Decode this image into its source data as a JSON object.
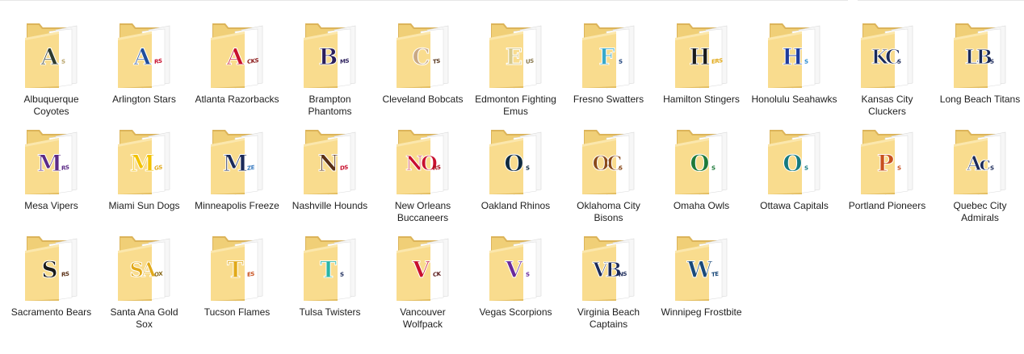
{
  "window": {
    "view": "large-icons"
  },
  "folders": [
    {
      "label": "Albuquerque Coyotes",
      "mono": "A",
      "color": "#2f3b2f",
      "accent": "#b9a46a",
      "tag": "S"
    },
    {
      "label": "Arlington Stars",
      "mono": "A",
      "color": "#1f4e9c",
      "accent": "#c8102e",
      "tag": "RS"
    },
    {
      "label": "Atlanta Razorbacks",
      "mono": "A",
      "color": "#c8102e",
      "accent": "#8b1a1a",
      "tag": "CKS"
    },
    {
      "label": "Brampton Phantoms",
      "mono": "B",
      "color": "#2b1f5c",
      "accent": "#2b1f5c",
      "tag": "MS"
    },
    {
      "label": "Cleveland Bobcats",
      "mono": "C",
      "color": "#c9a985",
      "accent": "#5a3a22",
      "tag": "TS"
    },
    {
      "label": "Edmonton Fighting Emus",
      "mono": "E",
      "color": "#d7c98a",
      "accent": "#8a7a50",
      "tag": "US"
    },
    {
      "label": "Fresno Swatters",
      "mono": "F",
      "color": "#3aa9c9",
      "accent": "#1b3f7a",
      "tag": "S"
    },
    {
      "label": "Hamilton Stingers",
      "mono": "H",
      "color": "#1a1a1a",
      "accent": "#e1a91a",
      "tag": "ERS"
    },
    {
      "label": "Honolulu Seahawks",
      "mono": "H",
      "color": "#1f3c9c",
      "accent": "#2a8bd1",
      "tag": "S"
    },
    {
      "label": "Kansas City Cluckers",
      "mono": "KC",
      "color": "#1b2a5a",
      "accent": "#1b2a5a",
      "tag": "S"
    },
    {
      "label": "Long Beach Titans",
      "mono": "LB",
      "color": "#1b2a5a",
      "accent": "#1b2a5a",
      "tag": "S"
    },
    {
      "label": "Mesa Vipers",
      "mono": "M",
      "color": "#5b2a86",
      "accent": "#5b2a86",
      "tag": "RS"
    },
    {
      "label": "Miami Sun Dogs",
      "mono": "M",
      "color": "#f2c200",
      "accent": "#e1a91a",
      "tag": "GS"
    },
    {
      "label": "Minneapolis Freeze",
      "mono": "M",
      "color": "#1b2a5a",
      "accent": "#3a7cc1",
      "tag": "ZE"
    },
    {
      "label": "Nashville Hounds",
      "mono": "N",
      "color": "#5a3016",
      "accent": "#c8102e",
      "tag": "DS"
    },
    {
      "label": "New Orleans Buccaneers",
      "mono": "NO",
      "color": "#c8102e",
      "accent": "#a8101e",
      "tag": "RS"
    },
    {
      "label": "Oakland Rhinos",
      "mono": "O",
      "color": "#0f2a3f",
      "accent": "#0f2a3f",
      "tag": "S"
    },
    {
      "label": "Oklahoma City Bisons",
      "mono": "OC",
      "color": "#8a4a1a",
      "accent": "#8a4a1a",
      "tag": "S"
    },
    {
      "label": "Omaha Owls",
      "mono": "O",
      "color": "#1e7a3a",
      "accent": "#1e7a3a",
      "tag": "S"
    },
    {
      "label": "Ottawa Capitals",
      "mono": "O",
      "color": "#157a80",
      "accent": "#157a80",
      "tag": "S"
    },
    {
      "label": "Portland Pioneers",
      "mono": "P",
      "color": "#c8501e",
      "accent": "#c8501e",
      "tag": "S"
    },
    {
      "label": "Quebec City Admirals",
      "mono": "Ac",
      "color": "#1b2a5a",
      "accent": "#1b2a5a",
      "tag": "S"
    },
    {
      "label": "Sacramento Bears",
      "mono": "S",
      "color": "#1a1a1a",
      "accent": "#5a3016",
      "tag": "RS"
    },
    {
      "label": "Santa Ana Gold Sox",
      "mono": "SA",
      "color": "#e1a91a",
      "accent": "#8a6a1a",
      "tag": "OX"
    },
    {
      "label": "Tucson Flames",
      "mono": "T",
      "color": "#e1a91a",
      "accent": "#c8501e",
      "tag": "ES"
    },
    {
      "label": "Tulsa Twisters",
      "mono": "T",
      "color": "#2ab5a6",
      "accent": "#1b2a5a",
      "tag": "S"
    },
    {
      "label": "Vancouver Wolfpack",
      "mono": "V",
      "color": "#c8102e",
      "accent": "#5a1a1a",
      "tag": "CK"
    },
    {
      "label": "Vegas Scorpions",
      "mono": "V",
      "color": "#6a2a9c",
      "accent": "#6a2a9c",
      "tag": "S"
    },
    {
      "label": "Virginia Beach Captains",
      "mono": "VB",
      "color": "#1b2a5a",
      "accent": "#1b2a5a",
      "tag": "NS"
    },
    {
      "label": "Winnipeg Frostbite",
      "mono": "W",
      "color": "#1b4a7a",
      "accent": "#1b4a7a",
      "tag": "TE"
    }
  ]
}
